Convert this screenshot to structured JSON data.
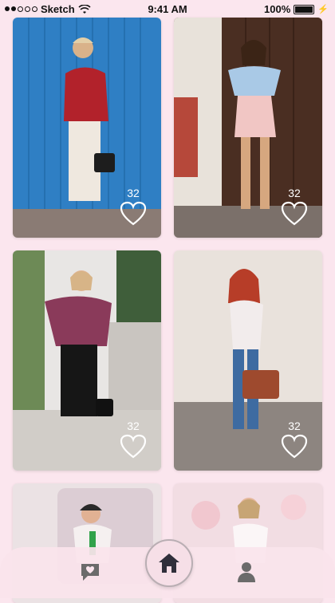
{
  "status_bar": {
    "carrier": "Sketch",
    "time": "9:41 AM",
    "battery": "100%"
  },
  "feed": [
    {
      "likes": "32"
    },
    {
      "likes": "32"
    },
    {
      "likes": "32"
    },
    {
      "likes": "32"
    },
    {
      "likes": ""
    },
    {
      "likes": ""
    }
  ],
  "colors": {
    "background": "#fbe6ee",
    "home_active": "#2f2f3a",
    "inactive_icon": "#6b6b6b"
  },
  "tabbar": {
    "icons": [
      "chat-icon",
      "home-icon",
      "profile-icon"
    ]
  }
}
